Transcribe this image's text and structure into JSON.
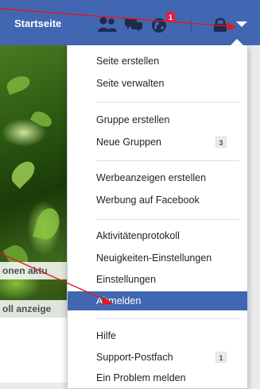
{
  "topbar": {
    "home_label": "Startseite",
    "notification_count": "1",
    "colors": {
      "bar": "#4267b2",
      "badge": "#e41e3f"
    }
  },
  "background": {
    "text_line_1": "onen aktu",
    "text_line_2": "oll anzeige"
  },
  "menu": {
    "groups": [
      {
        "items": [
          {
            "label": "Seite erstellen"
          },
          {
            "label": "Seite verwalten"
          }
        ]
      },
      {
        "items": [
          {
            "label": "Gruppe erstellen"
          },
          {
            "label": "Neue Gruppen",
            "badge": "3"
          }
        ]
      },
      {
        "items": [
          {
            "label": "Werbeanzeigen erstellen"
          },
          {
            "label": "Werbung auf Facebook"
          }
        ]
      },
      {
        "items": [
          {
            "label": "Aktivitätenprotokoll"
          },
          {
            "label": "Neuigkeiten-Einstellungen"
          },
          {
            "label": "Einstellungen"
          },
          {
            "label": "Abmelden",
            "highlighted": true
          }
        ]
      },
      {
        "items": [
          {
            "label": "Hilfe"
          },
          {
            "label": "Support-Postfach",
            "badge": "1"
          },
          {
            "label": "Ein Problem melden"
          }
        ]
      }
    ],
    "colors": {
      "highlight": "#4267b2",
      "text": "#1d2129"
    }
  },
  "annotations": {
    "color": "#e0191f"
  },
  "icons": [
    "friends-icon",
    "messages-icon",
    "globe-icon",
    "lock-icon",
    "menu-arrow-icon"
  ]
}
